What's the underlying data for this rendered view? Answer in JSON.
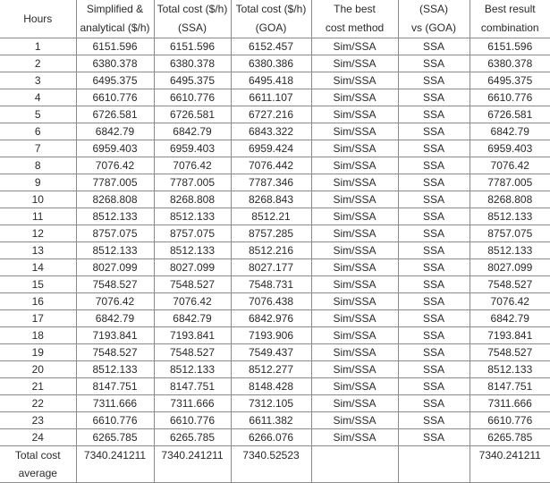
{
  "table": {
    "headers": [
      [
        "Hours"
      ],
      [
        "Simplified &",
        "analytical ($/h)"
      ],
      [
        "Total cost ($/h)",
        "(SSA)"
      ],
      [
        "Total cost ($/h)",
        "(GOA)"
      ],
      [
        "The best",
        "cost method"
      ],
      [
        "(SSA)",
        "vs (GOA)"
      ],
      [
        "Best result",
        "combination"
      ]
    ],
    "rows": [
      [
        "1",
        "6151.596",
        "6151.596",
        "6152.457",
        "Sim/SSA",
        "SSA",
        "6151.596"
      ],
      [
        "2",
        "6380.378",
        "6380.378",
        "6380.386",
        "Sim/SSA",
        "SSA",
        "6380.378"
      ],
      [
        "3",
        "6495.375",
        "6495.375",
        "6495.418",
        "Sim/SSA",
        "SSA",
        "6495.375"
      ],
      [
        "4",
        "6610.776",
        "6610.776",
        "6611.107",
        "Sim/SSA",
        "SSA",
        "6610.776"
      ],
      [
        "5",
        "6726.581",
        "6726.581",
        "6727.216",
        "Sim/SSA",
        "SSA",
        "6726.581"
      ],
      [
        "6",
        "6842.79",
        "6842.79",
        "6843.322",
        "Sim/SSA",
        "SSA",
        "6842.79"
      ],
      [
        "7",
        "6959.403",
        "6959.403",
        "6959.424",
        "Sim/SSA",
        "SSA",
        "6959.403"
      ],
      [
        "8",
        "7076.42",
        "7076.42",
        "7076.442",
        "Sim/SSA",
        "SSA",
        "7076.42"
      ],
      [
        "9",
        "7787.005",
        "7787.005",
        "7787.346",
        "Sim/SSA",
        "SSA",
        "7787.005"
      ],
      [
        "10",
        "8268.808",
        "8268.808",
        "8268.843",
        "Sim/SSA",
        "SSA",
        "8268.808"
      ],
      [
        "11",
        "8512.133",
        "8512.133",
        "8512.21",
        "Sim/SSA",
        "SSA",
        "8512.133"
      ],
      [
        "12",
        "8757.075",
        "8757.075",
        "8757.285",
        "Sim/SSA",
        "SSA",
        "8757.075"
      ],
      [
        "13",
        "8512.133",
        "8512.133",
        "8512.216",
        "Sim/SSA",
        "SSA",
        "8512.133"
      ],
      [
        "14",
        "8027.099",
        "8027.099",
        "8027.177",
        "Sim/SSA",
        "SSA",
        "8027.099"
      ],
      [
        "15",
        "7548.527",
        "7548.527",
        "7548.731",
        "Sim/SSA",
        "SSA",
        "7548.527"
      ],
      [
        "16",
        "7076.42",
        "7076.42",
        "7076.438",
        "Sim/SSA",
        "SSA",
        "7076.42"
      ],
      [
        "17",
        "6842.79",
        "6842.79",
        "6842.976",
        "Sim/SSA",
        "SSA",
        "6842.79"
      ],
      [
        "18",
        "7193.841",
        "7193.841",
        "7193.906",
        "Sim/SSA",
        "SSA",
        "7193.841"
      ],
      [
        "19",
        "7548.527",
        "7548.527",
        "7549.437",
        "Sim/SSA",
        "SSA",
        "7548.527"
      ],
      [
        "20",
        "8512.133",
        "8512.133",
        "8512.277",
        "Sim/SSA",
        "SSA",
        "8512.133"
      ],
      [
        "21",
        "8147.751",
        "8147.751",
        "8148.428",
        "Sim/SSA",
        "SSA",
        "8147.751"
      ],
      [
        "22",
        "7311.666",
        "7311.666",
        "7312.105",
        "Sim/SSA",
        "SSA",
        "7311.666"
      ],
      [
        "23",
        "6610.776",
        "6610.776",
        "6611.382",
        "Sim/SSA",
        "SSA",
        "6610.776"
      ],
      [
        "24",
        "6265.785",
        "6265.785",
        "6266.076",
        "Sim/SSA",
        "SSA",
        "6265.785"
      ]
    ],
    "footer": {
      "label": [
        "Total cost",
        "average"
      ],
      "values": [
        "7340.241211",
        "7340.241211",
        "7340.52523",
        "",
        "",
        "7340.241211"
      ]
    }
  }
}
